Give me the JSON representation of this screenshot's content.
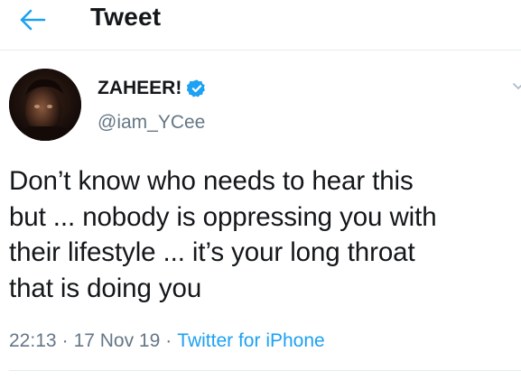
{
  "header": {
    "title": "Tweet",
    "back_icon": "arrow-left-icon",
    "accent": "#1da1f2"
  },
  "tweet": {
    "author": {
      "display_name": "ZAHEER!",
      "handle": "@iam_YCee",
      "verified": true,
      "verified_color": "#1da1f2"
    },
    "text": "Don’t know who needs to hear this\nbut ...  nobody is oppressing you with\ntheir lifestyle ... it’s your long throat\nthat is doing you",
    "time": "22:13",
    "date": "17 Nov 19",
    "source": "Twitter for iPhone",
    "separator": "·"
  },
  "colors": {
    "text": "#14171a",
    "secondary": "#657786",
    "link": "#1da1f2",
    "divider": "#e6ecf0"
  }
}
